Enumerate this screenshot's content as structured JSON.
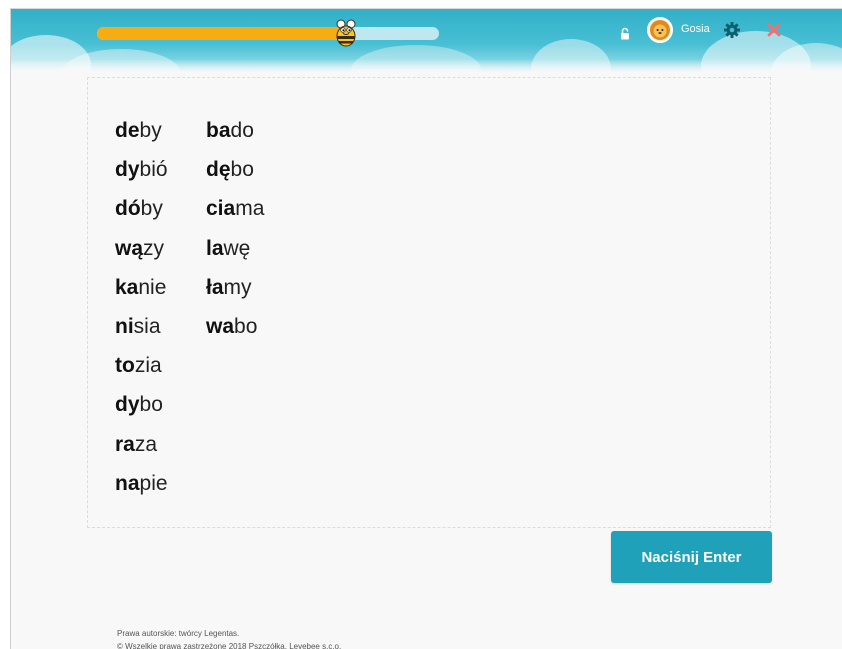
{
  "header": {
    "progress": 0.71,
    "username": "Gosia",
    "icons": {
      "mascot": "bee-icon",
      "lock": "lock-icon",
      "avatar": "lion-avatar-icon",
      "settings": "gear-icon",
      "close": "close-icon"
    },
    "colors": {
      "bar": "#48bfd4",
      "progress_fill": "#f6ac12",
      "progress_track": "#bfe7ef",
      "gear": "#0f5f6e",
      "close": "#ff6b6b"
    }
  },
  "words": {
    "left": [
      {
        "bold": "de",
        "rest": "by"
      },
      {
        "bold": "dy",
        "rest": "bió"
      },
      {
        "bold": "dó",
        "rest": "by"
      },
      {
        "bold": "wą",
        "rest": "zy"
      },
      {
        "bold": "ka",
        "rest": "nie"
      },
      {
        "bold": "ni",
        "rest": "sia"
      },
      {
        "bold": "to",
        "rest": "zia"
      },
      {
        "bold": "dy",
        "rest": "bo"
      },
      {
        "bold": "ra",
        "rest": "za"
      },
      {
        "bold": "na",
        "rest": "pie"
      }
    ],
    "right": [
      {
        "bold": "ba",
        "rest": "do"
      },
      {
        "bold": "dę",
        "rest": "bo"
      },
      {
        "bold": "cia",
        "rest": "ma"
      },
      {
        "bold": "la",
        "rest": "wę"
      },
      {
        "bold": "ła",
        "rest": "my"
      },
      {
        "bold": "wa",
        "rest": "bo"
      }
    ]
  },
  "actions": {
    "enter_label": "Naciśnij Enter",
    "button_color": "#1fa1b9"
  },
  "footer": {
    "line1": "Prawa autorskie: twórcy Legentas.",
    "line2": "© Wszelkie prawa zastrzeżone 2018 Pszczółka, Levebee s.c.o."
  }
}
